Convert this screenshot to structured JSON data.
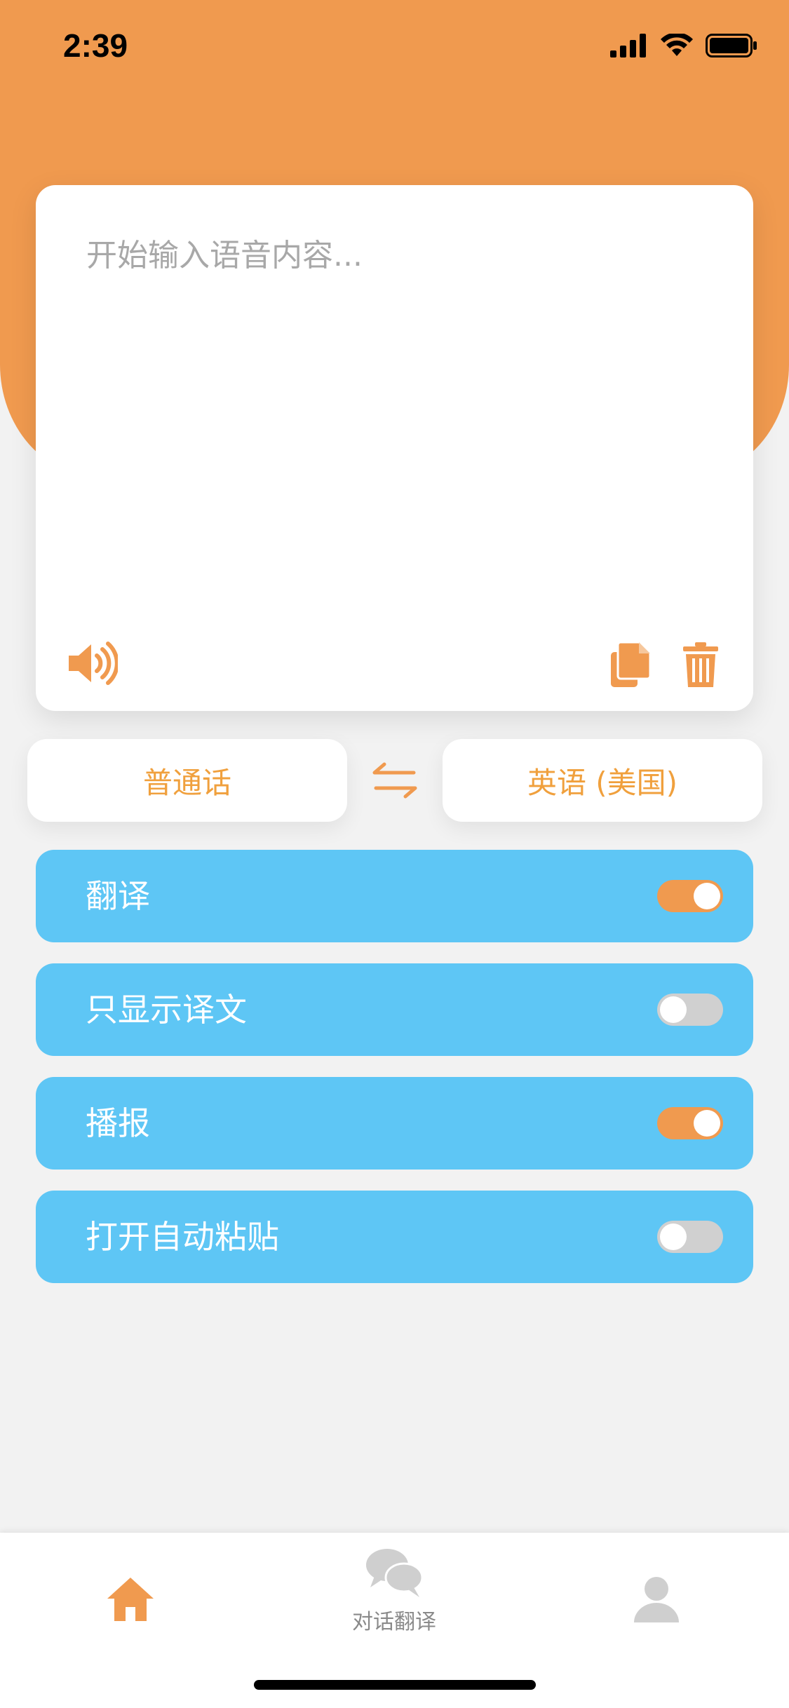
{
  "status_bar": {
    "time": "2:39",
    "icons": [
      "cellular-signal-icon",
      "wifi-icon",
      "battery-icon"
    ]
  },
  "input": {
    "placeholder": "开始输入语音内容..."
  },
  "languages": {
    "source": "普通话",
    "target": "英语 (美国)"
  },
  "toggles": [
    {
      "label": "翻译",
      "on": true
    },
    {
      "label": "只显示译文",
      "on": false
    },
    {
      "label": "播报",
      "on": true
    },
    {
      "label": "打开自动粘贴",
      "on": false
    }
  ],
  "tab_bar": {
    "items": [
      {
        "label": "",
        "icon": "home-icon",
        "active": true
      },
      {
        "label": "对话翻译",
        "icon": "chat-bubbles-icon",
        "active": false
      },
      {
        "label": "",
        "icon": "profile-icon",
        "active": false
      }
    ]
  },
  "colors": {
    "accent_orange": "#f09a4f",
    "row_blue": "#5ec6f5",
    "switch_off": "#d0d0d0",
    "background": "#f2f2f2"
  }
}
